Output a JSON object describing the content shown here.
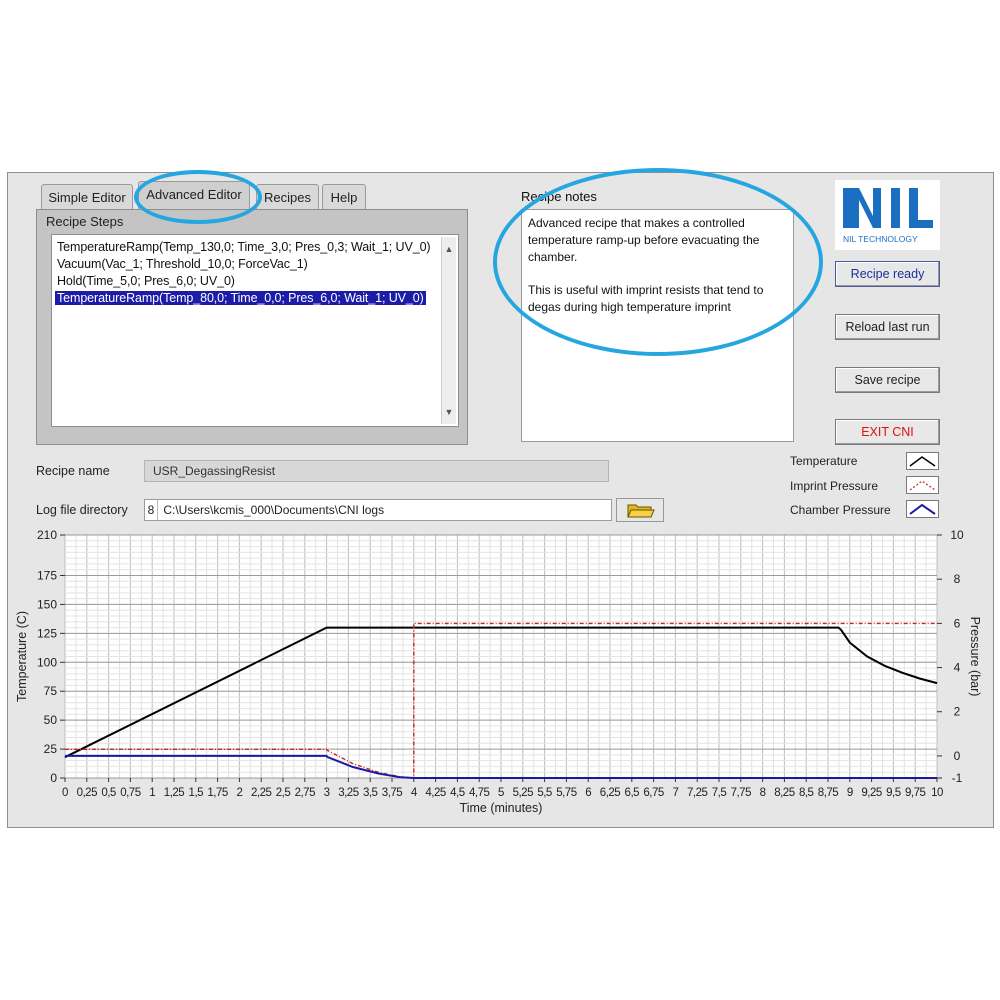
{
  "tabs": [
    {
      "label": "Simple Editor",
      "active": false
    },
    {
      "label": "Advanced Editor",
      "active": true
    },
    {
      "label": "Recipes",
      "active": false
    },
    {
      "label": "Help",
      "active": false
    }
  ],
  "recipe_steps": {
    "label": "Recipe Steps",
    "items": [
      "TemperatureRamp(Temp_130,0; Time_3,0; Pres_0,3; Wait_1; UV_0)",
      "Vacuum(Vac_1; Threshold_10,0; ForceVac_1)",
      "Hold(Time_5,0; Pres_6,0; UV_0)",
      "TemperatureRamp(Temp_80,0; Time_0,0; Pres_6,0; Wait_1; UV_0)"
    ],
    "selected_index": 3
  },
  "recipe_notes": {
    "label": "Recipe notes",
    "paragraph1": "Advanced recipe that makes a controlled temperature ramp-up before evacuating the chamber.",
    "paragraph2": "This is useful with imprint resists that tend to degas during high temperature imprint"
  },
  "logo": {
    "text": "NIL TECHNOLOGY",
    "color": "#1b6fc0"
  },
  "buttons": {
    "recipe_ready": "Recipe ready",
    "reload_last_run": "Reload last run",
    "save_recipe": "Save recipe",
    "exit": "EXIT CNI"
  },
  "recipe_name": {
    "label": "Recipe name",
    "value": "USR_DegassingResist"
  },
  "log_dir": {
    "label": "Log file directory",
    "prefix": "8",
    "value": "C:\\Users\\kcmis_000\\Documents\\CNI logs"
  },
  "legend": [
    {
      "label": "Temperature",
      "color": "#000000"
    },
    {
      "label": "Imprint Pressure",
      "color": "#cc2222"
    },
    {
      "label": "Chamber Pressure",
      "color": "#1a1aa0"
    }
  ],
  "chart_data": {
    "type": "line",
    "xlabel": "Time (minutes)",
    "ylabel": "Temperature (C)",
    "y2label": "Pressure (bar)",
    "xlim": [
      0,
      10
    ],
    "ylim": [
      0,
      210
    ],
    "y2lim": [
      -1,
      10
    ],
    "x_ticks": [
      "0",
      "0,25",
      "0,5",
      "0,75",
      "1",
      "1,25",
      "1,5",
      "1,75",
      "2",
      "2,25",
      "2,5",
      "2,75",
      "3",
      "3,25",
      "3,5",
      "3,75",
      "4",
      "4,25",
      "4,5",
      "4,75",
      "5",
      "5,25",
      "5,5",
      "5,75",
      "6",
      "6,25",
      "6,5",
      "6,75",
      "7",
      "7,25",
      "7,5",
      "7,75",
      "8",
      "8,25",
      "8,5",
      "8,75",
      "9",
      "9,25",
      "9,5",
      "9,75",
      "10"
    ],
    "y_ticks": [
      "0",
      "25",
      "50",
      "75",
      "100",
      "125",
      "150",
      "175",
      "210"
    ],
    "y2_ticks": [
      "-1",
      "0",
      "2",
      "4",
      "6",
      "8",
      "10"
    ],
    "grid": true,
    "series": [
      {
        "name": "Temperature",
        "axis": "left",
        "color": "#000000",
        "x": [
          0,
          3,
          3.01,
          4,
          8.87,
          8.9,
          9.0,
          9.2,
          9.4,
          9.6,
          9.8,
          10
        ],
        "y": [
          18,
          130,
          130,
          130,
          130,
          128,
          117,
          105,
          97,
          91,
          86,
          82
        ]
      },
      {
        "name": "Imprint Pressure",
        "axis": "right",
        "color": "#cc2222",
        "x": [
          0,
          3,
          3.01,
          3.3,
          3.6,
          3.85,
          4.0,
          4.0,
          10
        ],
        "y": [
          0.3,
          0.3,
          0.25,
          -0.35,
          -0.75,
          -0.95,
          -1,
          6,
          6
        ]
      },
      {
        "name": "Chamber Pressure",
        "axis": "right",
        "color": "#1a1aa0",
        "x": [
          0,
          3,
          3.01,
          3.3,
          3.6,
          3.85,
          4.0,
          10
        ],
        "y": [
          0,
          0,
          -0.05,
          -0.5,
          -0.8,
          -0.97,
          -1,
          -1
        ]
      }
    ]
  }
}
